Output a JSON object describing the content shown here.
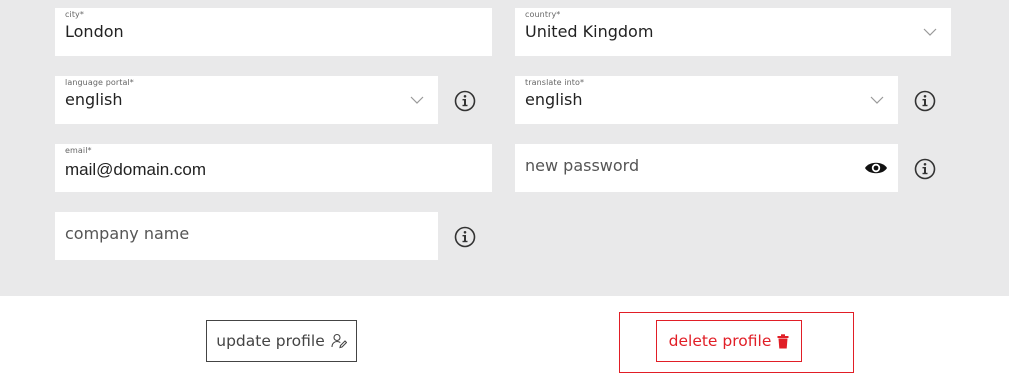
{
  "form": {
    "city": {
      "label": "city*",
      "value": "London"
    },
    "country": {
      "label": "country*",
      "value": "United Kingdom"
    },
    "language_portal": {
      "label": "language portal*",
      "value": "english"
    },
    "translate_into": {
      "label": "translate into*",
      "value": "english"
    },
    "email": {
      "label": "email*",
      "value": "mail@domain.com"
    },
    "new_password": {
      "placeholder": "new password"
    },
    "company_name": {
      "placeholder": "company name"
    }
  },
  "actions": {
    "update_label": "update profile",
    "delete_label": "delete profile"
  },
  "colors": {
    "panel_bg": "#e9e9ea",
    "delete_red": "#e11e26",
    "icon_gray": "#555555"
  },
  "icons": {
    "chevron": "chevron-down-icon",
    "info": "info-icon",
    "eye": "eye-icon",
    "user_edit": "user-edit-icon",
    "trash": "trash-icon"
  }
}
